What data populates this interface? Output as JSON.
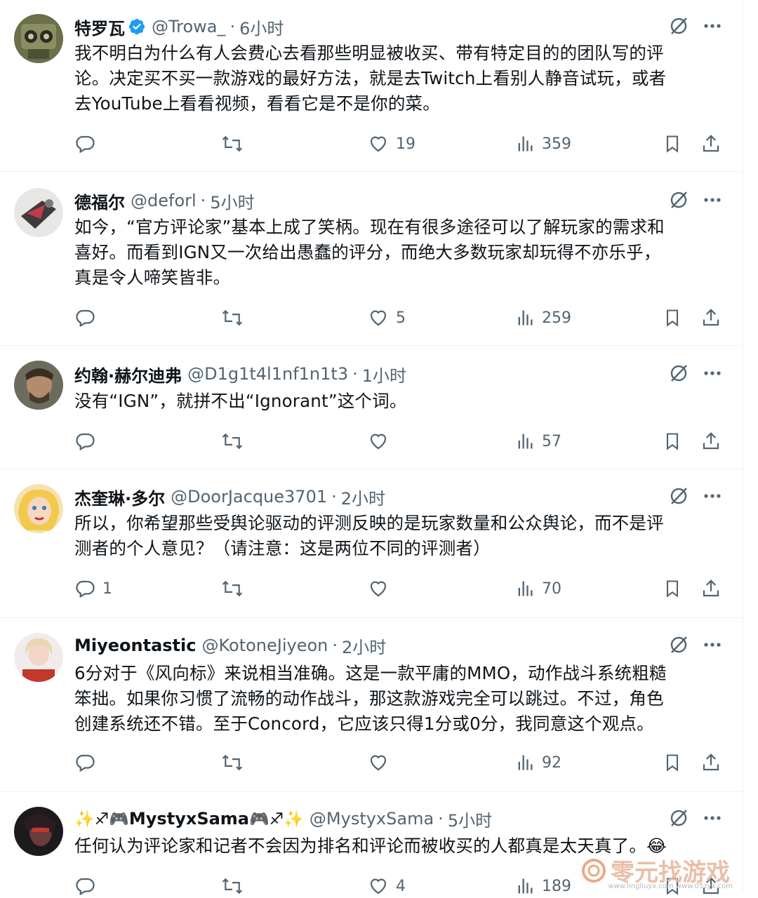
{
  "tweets": [
    {
      "name": "特罗瓦",
      "verified": true,
      "handle": "@Trowa_",
      "time": "6小时",
      "text": [
        "我不明白为什么有人会费心去看那些明显被收买、带有特定目的的团队写的评",
        "论。决定买不买一款游戏的最好方法，就是去Twitch上看别人静音试玩，或者",
        "去YouTube上看看视频，看看它是不是你的菜。"
      ],
      "replies": "",
      "likes": "19",
      "views": "359"
    },
    {
      "name": "德福尔",
      "verified": false,
      "handle": "@deforl",
      "time": "5小时",
      "text": [
        "如今，“官方评论家”基本上成了笑柄。现在有很多途径可以了解玩家的需求和",
        "喜好。而看到IGN又一次给出愚蠢的评分，而绝大多数玩家却玩得不亦乐乎，",
        "真是令人啼笑皆非。"
      ],
      "replies": "",
      "likes": "5",
      "views": "259"
    },
    {
      "name": "约翰·赫尔迪弗",
      "verified": false,
      "handle": "@D1g1t4l1nf1n1t3",
      "time": "1小时",
      "text": [
        "没有“IGN”，就拼不出“Ignorant”这个词。"
      ],
      "replies": "",
      "likes": "",
      "views": "57"
    },
    {
      "name": "杰奎琳·多尔",
      "verified": false,
      "handle": "@DoorJacque3701",
      "time": "2小时",
      "text": [
        "所以，你希望那些受舆论驱动的评测反映的是玩家数量和公众舆论，而不是评",
        "测者的个人意见？（请注意：这是两位不同的评测者）"
      ],
      "replies": "1",
      "likes": "",
      "views": "70"
    },
    {
      "name": "Miyeontastic",
      "verified": false,
      "handle": "@KotoneJiyeon",
      "time": "2小时",
      "text": [
        "6分对于《风向标》来说相当准确。这是一款平庸的MMO，动作战斗系统粗糙",
        "笨拙。如果你习惯了流畅的动作战斗，那这款游戏完全可以跳过。不过，角色",
        "创建系统还不错。至于Concord，它应该只得1分或0分，我同意这个观点。"
      ],
      "replies": "",
      "likes": "",
      "views": "92"
    },
    {
      "name_prefix": "✨♐🎮",
      "name": "MystyxSama",
      "name_suffix": "🎮♐✨",
      "verified": false,
      "handle": "@MystyxSama",
      "time": "5小时",
      "text": [
        "任何认为评论家和记者不会因为排名和评论而被收买的人都真是太天真了。😂"
      ],
      "replies": "",
      "likes": "4",
      "views": "189"
    }
  ],
  "icons": {
    "reply": "reply-icon",
    "retweet": "retweet-icon",
    "like": "heart-icon",
    "views": "views-icon",
    "bookmark": "bookmark-icon",
    "share": "share-icon",
    "grok": "grok-icon",
    "more": "more-icon"
  },
  "colors": {
    "verified": "#1d9bf0",
    "muted": "#536471",
    "text": "#0f1419",
    "divider": "#eff3f4"
  },
  "watermark": {
    "brand": "零元找游戏",
    "url": "www.lingliuyx.com www.05zyx.com"
  }
}
